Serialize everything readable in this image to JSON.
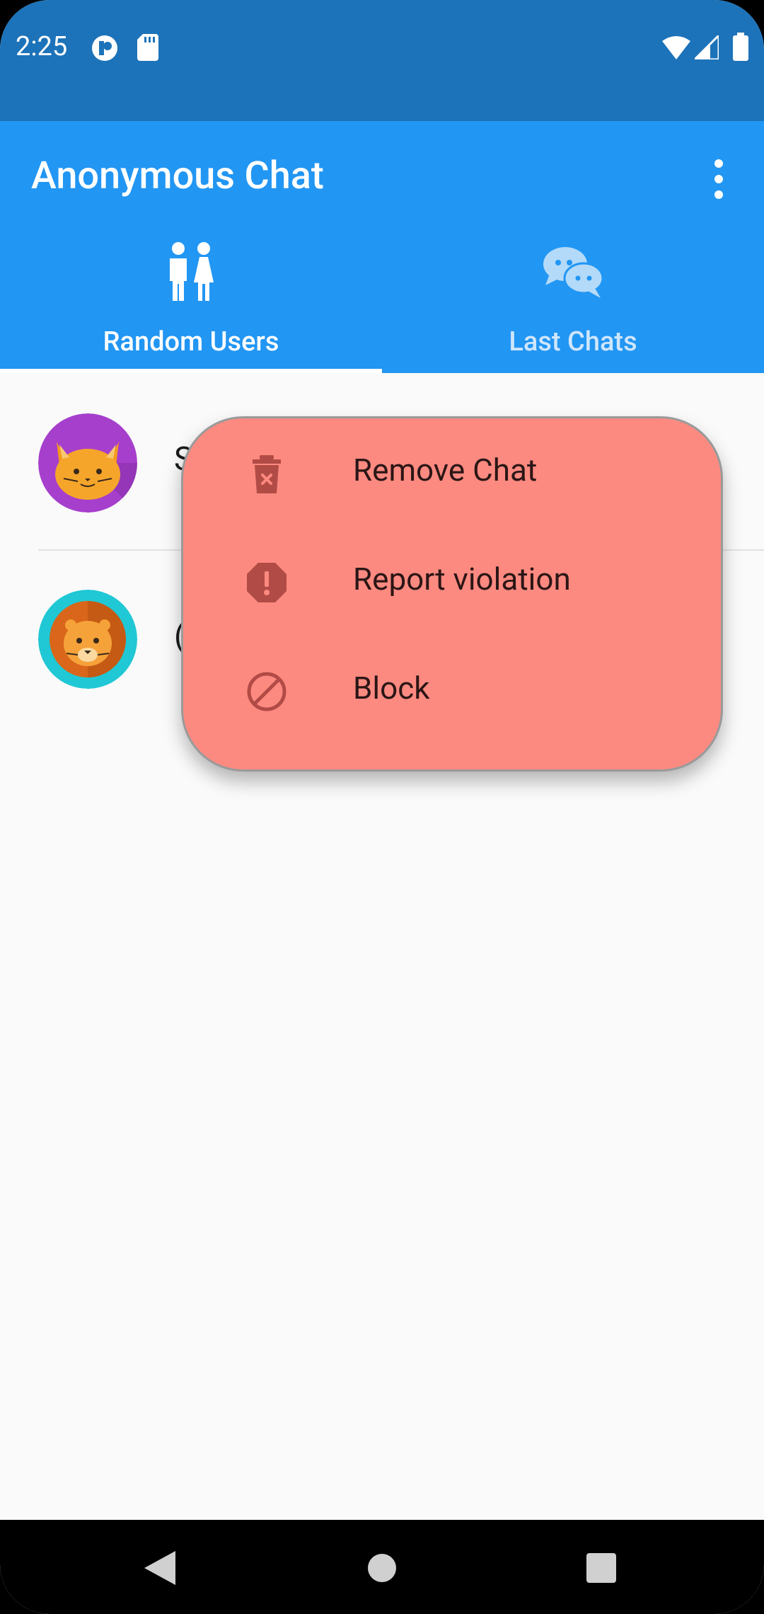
{
  "status_bar": {
    "time": "2:25",
    "icons": [
      "app-notification-icon",
      "sd-card-icon",
      "wifi-icon",
      "signal-icon",
      "battery-icon"
    ]
  },
  "app_bar": {
    "title": "Anonymous Chat",
    "menu_icon": "more-vert-icon",
    "tabs": [
      {
        "label": "Random Users",
        "icon": "people-icon",
        "selected": true
      },
      {
        "label": "Last Chats",
        "icon": "chat-bubbles-icon",
        "selected": false
      }
    ]
  },
  "list": {
    "rows": [
      {
        "avatar": "cat-avatar",
        "name_partial": "S"
      },
      {
        "avatar": "lion-avatar",
        "name_partial": "("
      }
    ]
  },
  "context_menu": {
    "items": [
      {
        "label": "Remove Chat",
        "icon": "delete-icon"
      },
      {
        "label": "Report violation",
        "icon": "report-icon"
      },
      {
        "label": "Block",
        "icon": "block-icon"
      }
    ]
  },
  "nav_bar": {
    "buttons": [
      "back-icon",
      "home-icon",
      "recents-icon"
    ]
  },
  "colors": {
    "status_bar": "#1c73b9",
    "app_bar": "#2296f3",
    "menu_background": "#fd8a80",
    "menu_icon": "#b14b45"
  }
}
